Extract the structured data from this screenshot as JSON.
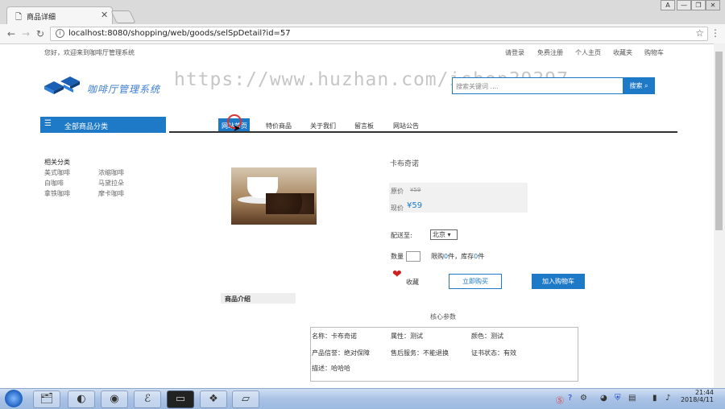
{
  "browser": {
    "tab_title": "商品详细",
    "tab_icon": "page-icon",
    "url": "localhost:8080/shopping/web/goods/selSpDetail?id=57",
    "window_buttons": [
      "A",
      "—",
      "❐",
      "✕"
    ]
  },
  "top_bar": {
    "greeting": "您好，欢迎来到咖啡厅管理系统",
    "links": [
      "请登录",
      "免费注册",
      "个人主页",
      "收藏夹",
      "购物车"
    ]
  },
  "header": {
    "logo_text": "咖啡厅管理系统",
    "watermark": "https://www.huzhan.com/ishop39397",
    "search_placeholder": "搜索关键词 ....",
    "search_button": "搜索"
  },
  "category_bar": {
    "label": "全部商品分类"
  },
  "main_nav": {
    "items": [
      "网站首页",
      "特价商品",
      "关于我们",
      "留言板",
      "网站公告"
    ],
    "active": "网站首页"
  },
  "related": {
    "title": "相关分类",
    "items": [
      "美式咖啡",
      "浓缩咖啡",
      "白咖啡",
      "马黛拉朵",
      "拿铁咖啡",
      "摩卡咖啡"
    ]
  },
  "product": {
    "name": "卡布奇诺",
    "orig_price_label": "原价",
    "orig_price": "¥59",
    "cur_price_label": "现价",
    "cur_price": "¥59",
    "deliver_label": "配送至:",
    "deliver_value": "北京",
    "qty_label": "数量",
    "limit_prefix": "限购",
    "limit_value": "0",
    "limit_unit": "件，库存",
    "stock_value": "0",
    "stock_unit": "件",
    "fav_label": "收藏",
    "buy_now": "立即购买",
    "add_cart": "加入购物车"
  },
  "intro": {
    "tab_label": "商品介绍",
    "core_title": "核心参数",
    "params": [
      [
        "名称：卡布奇诺",
        "属性：测试",
        "颜色：测试"
      ],
      [
        "产品信誉：绝对保障",
        "售后服务：不能退换",
        "证书状态：有效"
      ],
      [
        "描述：哈哈哈",
        "",
        ""
      ]
    ]
  },
  "taskbar": {
    "apps": [
      "windows-explorer-icon",
      "qq-browser-icon",
      "chrome-icon",
      "eclipse-icon",
      "cmd-icon",
      "folder-icon",
      "app-icon"
    ],
    "time": "21:44",
    "date": "2018/4/11"
  },
  "colors": {
    "accent": "#1e79c7"
  }
}
